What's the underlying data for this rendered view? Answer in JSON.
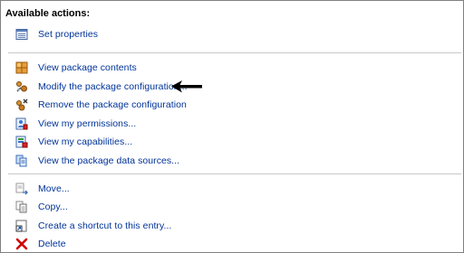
{
  "panel": {
    "heading": "Available actions:"
  },
  "actions": [
    {
      "label": "Set properties",
      "icon": "properties-icon"
    },
    {
      "label": "View package contents",
      "icon": "package-contents-icon"
    },
    {
      "label": "Modify the package configuration...",
      "icon": "modify-configuration-icon"
    },
    {
      "label": "Remove the package configuration",
      "icon": "remove-configuration-icon"
    },
    {
      "label": "View my permissions...",
      "icon": "permissions-icon"
    },
    {
      "label": "View my capabilities...",
      "icon": "capabilities-icon"
    },
    {
      "label": "View the package data sources...",
      "icon": "data-sources-icon"
    },
    {
      "label": "Move...",
      "icon": "move-icon"
    },
    {
      "label": "Copy...",
      "icon": "copy-icon"
    },
    {
      "label": "Create a shortcut to this entry...",
      "icon": "shortcut-icon"
    },
    {
      "label": "Delete",
      "icon": "delete-icon"
    }
  ],
  "colors": {
    "link": "#003399",
    "divider": "#c8c8c8",
    "delete": "#d10000"
  }
}
